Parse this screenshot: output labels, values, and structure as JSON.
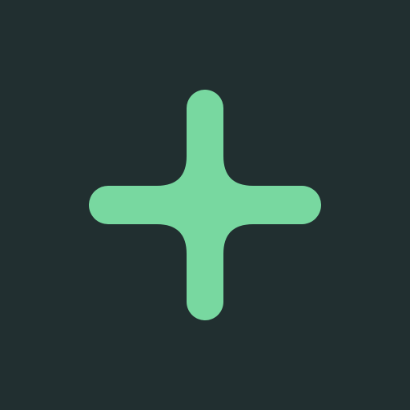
{
  "icon": {
    "name": "plus-icon"
  },
  "colors": {
    "background": "#212f30",
    "accent": "#78d8a0"
  }
}
